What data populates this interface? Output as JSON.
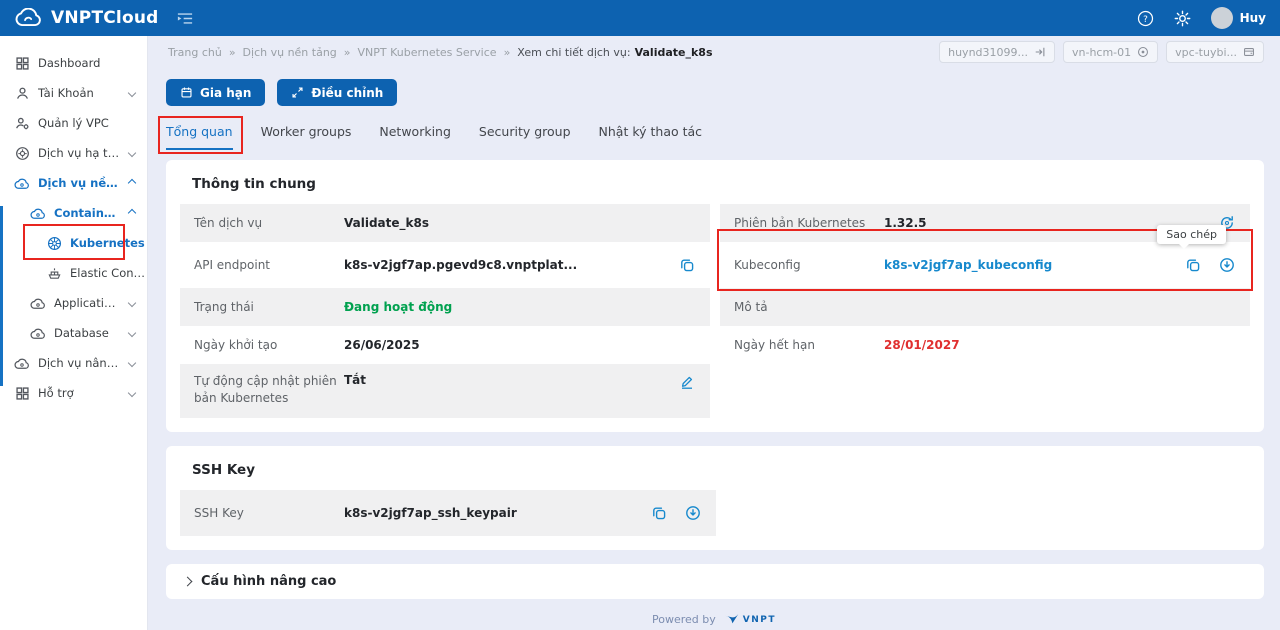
{
  "header": {
    "brand": "VNPTCloud",
    "user": "Huy"
  },
  "sidebar": [
    {
      "label": "Dashboard",
      "icon": "dashboard-icon"
    },
    {
      "label": "Tài Khoản",
      "icon": "user-icon",
      "chevron": "down"
    },
    {
      "label": "Quản lý VPC",
      "icon": "users-gear-icon"
    },
    {
      "label": "Dịch vụ hạ tầng",
      "icon": "gear-circle-icon",
      "chevron": "down"
    },
    {
      "label": "Dịch vụ nền tảng",
      "icon": "cloud-gear-icon",
      "chevron": "up"
    },
    {
      "label": "Containers",
      "icon": "cloud-gear-icon",
      "chevron": "up"
    },
    {
      "label": "Kubernetes",
      "icon": "kubernetes-icon"
    },
    {
      "label": "Elastic Contai...",
      "icon": "container-ship-icon"
    },
    {
      "label": "Application Int...",
      "icon": "cloud-gear-icon",
      "chevron": "down"
    },
    {
      "label": "Database",
      "icon": "cloud-gear-icon",
      "chevron": "down"
    },
    {
      "label": "Dịch vụ nâng cao",
      "icon": "cloud-gear-icon",
      "chevron": "down"
    },
    {
      "label": "Hỗ trợ",
      "icon": "dashboard-icon",
      "chevron": "down"
    }
  ],
  "breadcrumb": {
    "separator": "»",
    "items": [
      "Trang chủ",
      "Dịch vụ nền tảng",
      "VNPT Kubernetes Service"
    ],
    "current_label": "Xem chi tiết dịch vụ:",
    "current_value": "Validate_k8s"
  },
  "context_pills": [
    {
      "label": "huynd31099...",
      "icon": "project-switch-icon"
    },
    {
      "label": "vn-hcm-01",
      "icon": "region-globe-icon"
    },
    {
      "label": "vpc-tuybi...",
      "icon": "vpc-box-icon"
    }
  ],
  "actions": {
    "renew": "Gia hạn",
    "adjust": "Điều chỉnh"
  },
  "tabs": [
    "Tổng quan",
    "Worker groups",
    "Networking",
    "Security group",
    "Nhật ký thao tác"
  ],
  "general": {
    "title": "Thông tin chung",
    "left": [
      {
        "label": "Tên dịch vụ",
        "value": "Validate_k8s"
      },
      {
        "label": "API endpoint",
        "value": "k8s-v2jgf7ap.pgevd9c8.vnptplat..."
      },
      {
        "label": "Trạng thái",
        "value": "Đang hoạt động"
      },
      {
        "label": "Ngày khởi tạo",
        "value": "26/06/2025"
      },
      {
        "label": "Tự động cập nhật phiên bản Kubernetes",
        "value": "Tắt"
      }
    ],
    "right": [
      {
        "label": "Phiên bản Kubernetes",
        "value": "1.32.5"
      },
      {
        "label": "Kubeconfig",
        "value": "k8s-v2jgf7ap_kubeconfig"
      },
      {
        "label": "Mô tả",
        "value": ""
      },
      {
        "label": "Ngày hết hạn",
        "value": "28/01/2027"
      }
    ]
  },
  "tooltip": "Sao chép",
  "ssh": {
    "title": "SSH Key",
    "label": "SSH Key",
    "value": "k8s-v2jgf7ap_ssh_keypair"
  },
  "advanced_title": "Cấu hình nâng cao",
  "footer": {
    "powered_by": "Powered by",
    "brand": "VNPT"
  },
  "colors": {
    "header_blue": "#0d62b0",
    "accent_blue": "#1672c3",
    "link_blue": "#1789cd",
    "status_green": "#00a14f",
    "danger_red": "#e02f2f",
    "annotation_red": "#e8251f"
  }
}
